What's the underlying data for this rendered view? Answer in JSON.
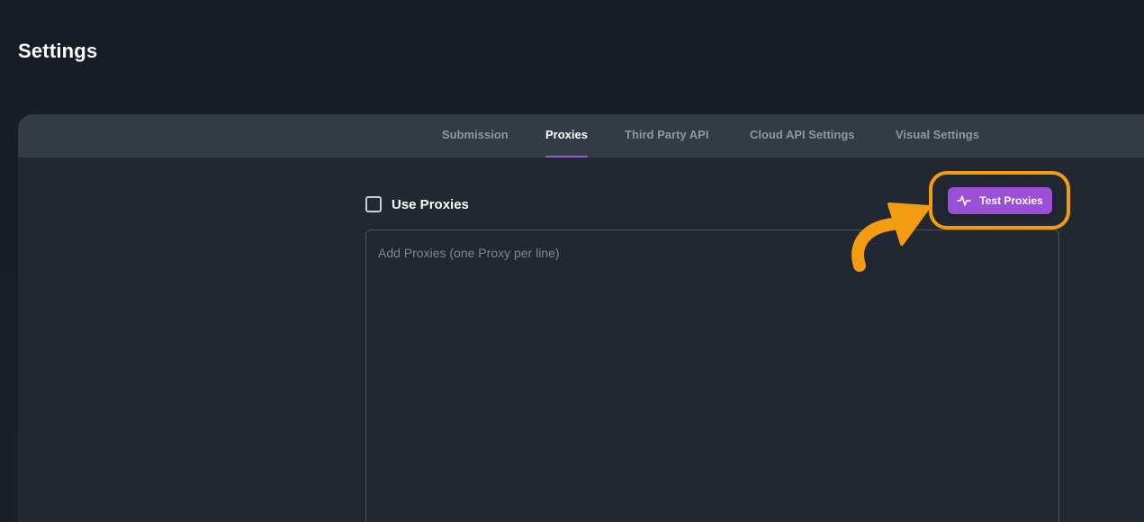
{
  "page": {
    "title": "Settings"
  },
  "tabs": [
    {
      "label": "Submission",
      "active": false
    },
    {
      "label": "Proxies",
      "active": true
    },
    {
      "label": "Third Party API",
      "active": false
    },
    {
      "label": "Cloud API Settings",
      "active": false
    },
    {
      "label": "Visual Settings",
      "active": false
    }
  ],
  "proxies": {
    "use_proxies_label": "Use Proxies",
    "use_proxies_checked": false,
    "textarea_placeholder": "Add Proxies (one Proxy per line)",
    "textarea_value": "",
    "test_button_label": "Test Proxies",
    "test_button_icon": "activity-icon"
  },
  "annotation": {
    "highlight_color": "#f39c12",
    "arrow_icon": "curved-arrow-icon"
  },
  "colors": {
    "accent": "#9b4fd6",
    "background": "#171c25",
    "panel": "#222832",
    "tabbar": "#333b45"
  }
}
